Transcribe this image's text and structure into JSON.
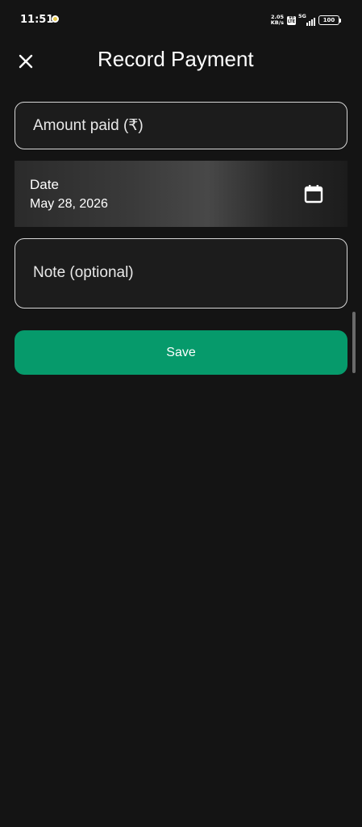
{
  "status_bar": {
    "time": "11:51",
    "net_speed_value": "2.05",
    "net_speed_unit": "KB/s",
    "volte_top": "Vo",
    "volte_bottom": "LTE",
    "signal_type": "5G",
    "battery_level": "100"
  },
  "header": {
    "title": "Record Payment",
    "close_icon": "close-icon"
  },
  "form": {
    "amount_placeholder": "Amount paid (₹)",
    "date_label": "Date",
    "date_value": "May 28, 2026",
    "date_icon": "calendar-icon",
    "note_placeholder": "Note (optional)",
    "save_label": "Save"
  },
  "colors": {
    "background": "#141414",
    "accent": "#069a6b",
    "field_border": "#d7d7d7"
  }
}
